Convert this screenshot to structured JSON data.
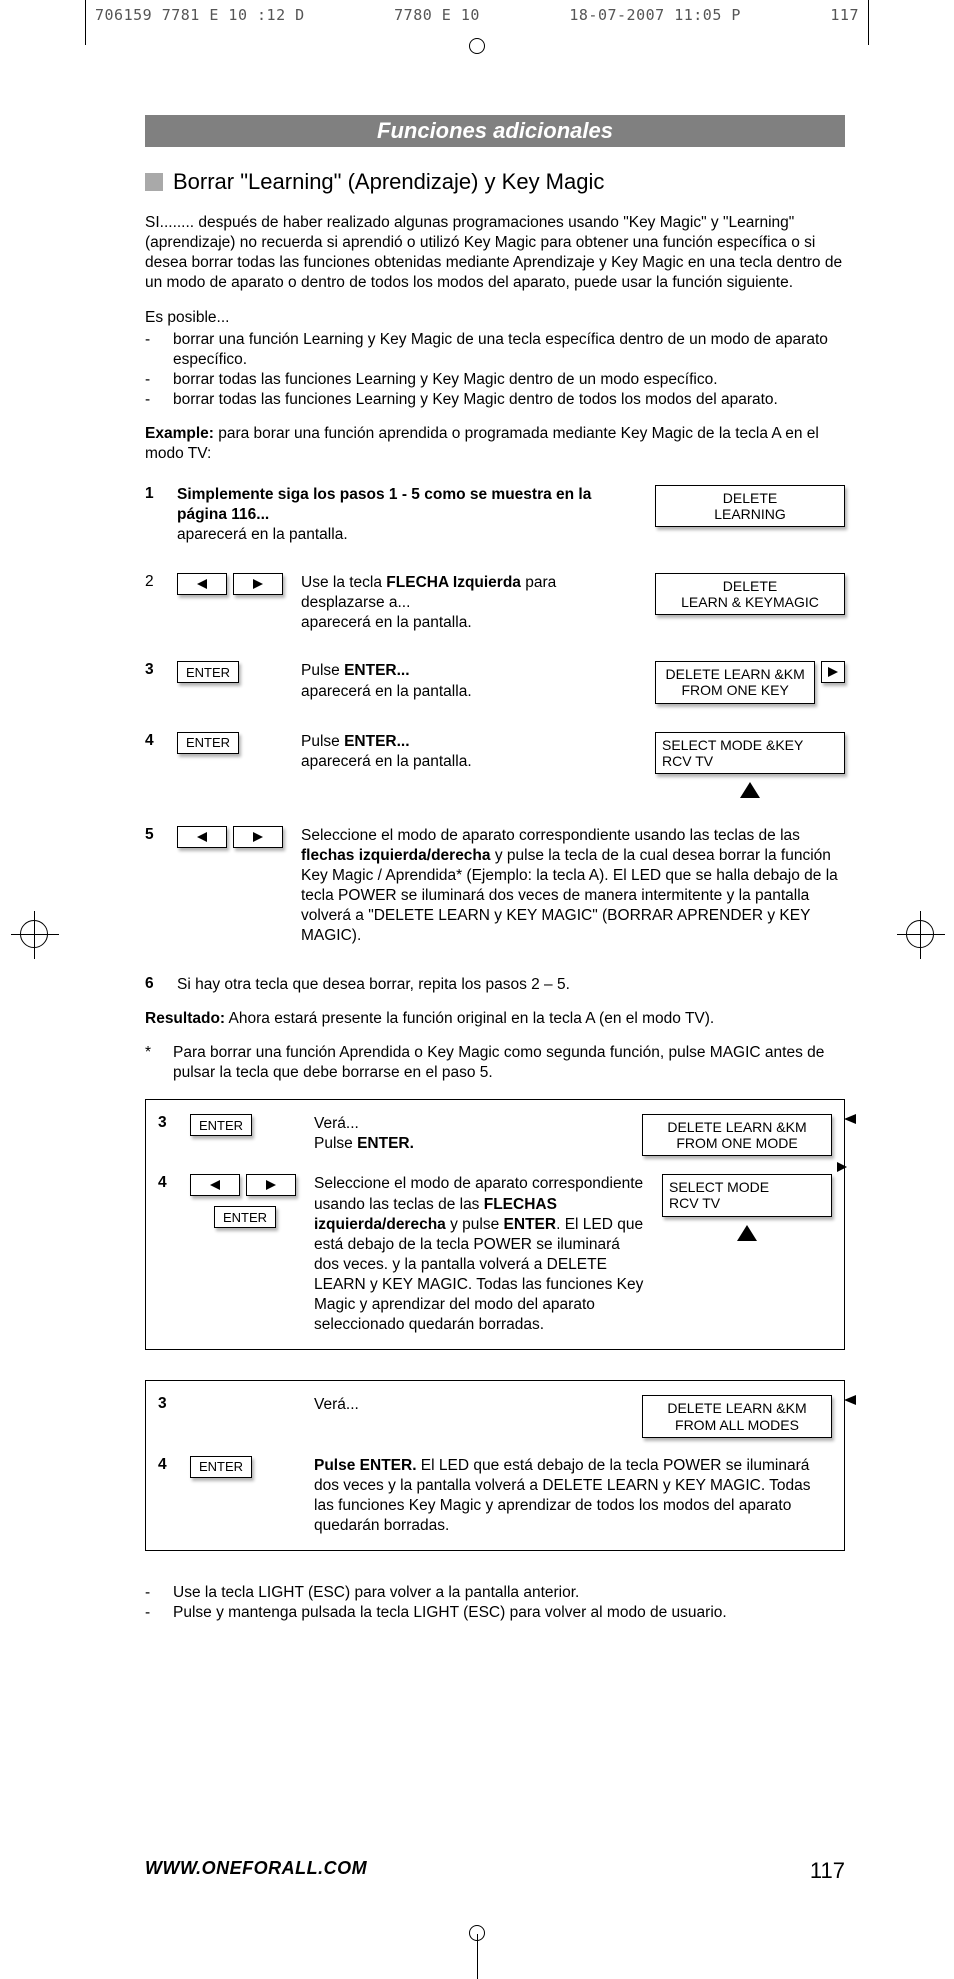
{
  "meta": {
    "left": "706159 7781 E 10 :12 D",
    "mid": "7780 E   10",
    "date": "18-07-2007  11:05  P",
    "page_slug": "117"
  },
  "title_bar": "Funciones adicionales",
  "section_title": "Borrar \"Learning\" (Aprendizaje) y Key Magic",
  "intro": "SI........ después de haber realizado algunas programaciones usando \"Key Magic\" y \"Learning\" (aprendizaje) no recuerda si aprendió o utilizó Key Magic para obtener una función específica o si desea borrar todas las funciones obtenidas mediante Aprendizaje y Key Magic en una tecla dentro de un modo de aparato o dentro de todos los modos del aparato, puede usar la función siguiente.",
  "possible_label": "Es posible...",
  "possible": [
    "borrar una función Learning y Key Magic de una tecla específica dentro de un modo de aparato específico.",
    "borrar todas las funciones Learning y Key Magic dentro de un modo específico.",
    "borrar todas las funciones Learning y Key Magic dentro de todos los modos del aparato."
  ],
  "example_label": "Example:",
  "example_text": " para borar una función aprendida o programada mediante Key Magic de la tecla A en el modo TV:",
  "steps_main": {
    "s1": {
      "num": "1",
      "bold": "Simplemente siga los pasos 1 - 5 como se muestra en la página 116...",
      "tail": "aparecerá en la pantalla.",
      "lcd": "DELETE\nLEARNING"
    },
    "s2": {
      "num": "2",
      "pre": "Use la tecla ",
      "bold": "FLECHA Izquierda",
      "mid": " para desplazarse a...",
      "tail": "aparecerá en la pantalla.",
      "lcd": "DELETE\nLEARN & KEYMAGIC"
    },
    "s3": {
      "num": "3",
      "key": "ENTER",
      "pre": "Pulse ",
      "bold": "ENTER...",
      "tail": "aparecerá en la pantalla.",
      "lcd": "DELETE LEARN &KM\nFROM ONE KEY"
    },
    "s4": {
      "num": "4",
      "key": "ENTER",
      "pre": "Pulse ",
      "bold": "ENTER...",
      "tail": "aparecerá en la pantalla.",
      "lcd": "SELECT MODE &KEY\nRCV   TV"
    },
    "s5": {
      "num": "5",
      "text_a": "Seleccione el modo de aparato correspondiente usando las teclas de las ",
      "text_b_bold": "flechas izquierda/derecha",
      "text_c": " y pulse la tecla de la cual desea borrar la función Key Magic / Aprendida* (Ejemplo: la tecla A). El LED que se halla debajo de la tecla POWER se iluminará dos veces de manera intermitente y la pantalla volverá a \"DELETE LEARN y KEY MAGIC\" (BORRAR APRENDER y KEY MAGIC)."
    },
    "s6": {
      "num": "6",
      "text": "Si hay otra tecla que desea borrar, repita los pasos 2 – 5."
    }
  },
  "resultado_label": "Resultado:",
  "resultado_text": "  Ahora estará presente la función original en la tecla A (en el modo TV).",
  "asterisk_label": "*",
  "asterisk_text": "Para borrar una función Aprendida o Key Magic como segunda función, pulse MAGIC antes de pulsar la tecla que debe borrarse en el paso 5.",
  "box_a": {
    "s3": {
      "num": "3",
      "key": "ENTER",
      "line1": "Verá...",
      "pre": "Pulse ",
      "bold": "ENTER.",
      "lcd": "DELETE LEARN &KM\nFROM ONE MODE"
    },
    "s4": {
      "num": "4",
      "key": "ENTER",
      "text_a": "Seleccione el modo de aparato correspondiente usando las teclas de las ",
      "text_b_bold": "FLECHAS izquierda/derecha",
      "text_c": " y pulse ",
      "text_d_bold": "ENTER",
      "text_e": ". El LED que está debajo de la tecla POWER se iluminará dos veces. y la pantalla volverá a DELETE LEARN y KEY MAGIC. Todas las funciones Key Magic y aprendizar del modo del aparato seleccionado quedarán borradas.",
      "lcd": "SELECT MODE\nRCV   TV"
    }
  },
  "box_b": {
    "s3": {
      "num": "3",
      "line1": "Verá...",
      "lcd": "DELETE LEARN &KM\nFROM ALL MODES"
    },
    "s4": {
      "num": "4",
      "key": "ENTER",
      "bold": "Pulse ENTER.",
      "text": " El LED que está debajo de la tecla POWER se iluminará dos veces y la pantalla volverá a DELETE LEARN y KEY MAGIC. Todas las funciones Key Magic y aprendizar de todos los modos del aparato quedarán borradas."
    }
  },
  "foot_notes": [
    "Use la tecla LIGHT (ESC) para volver a la pantalla anterior.",
    "Pulse y mantenga pulsada la tecla LIGHT (ESC) para volver al modo de usuario."
  ],
  "footer_url": "WWW.ONEFORALL.COM",
  "footer_page": "117"
}
